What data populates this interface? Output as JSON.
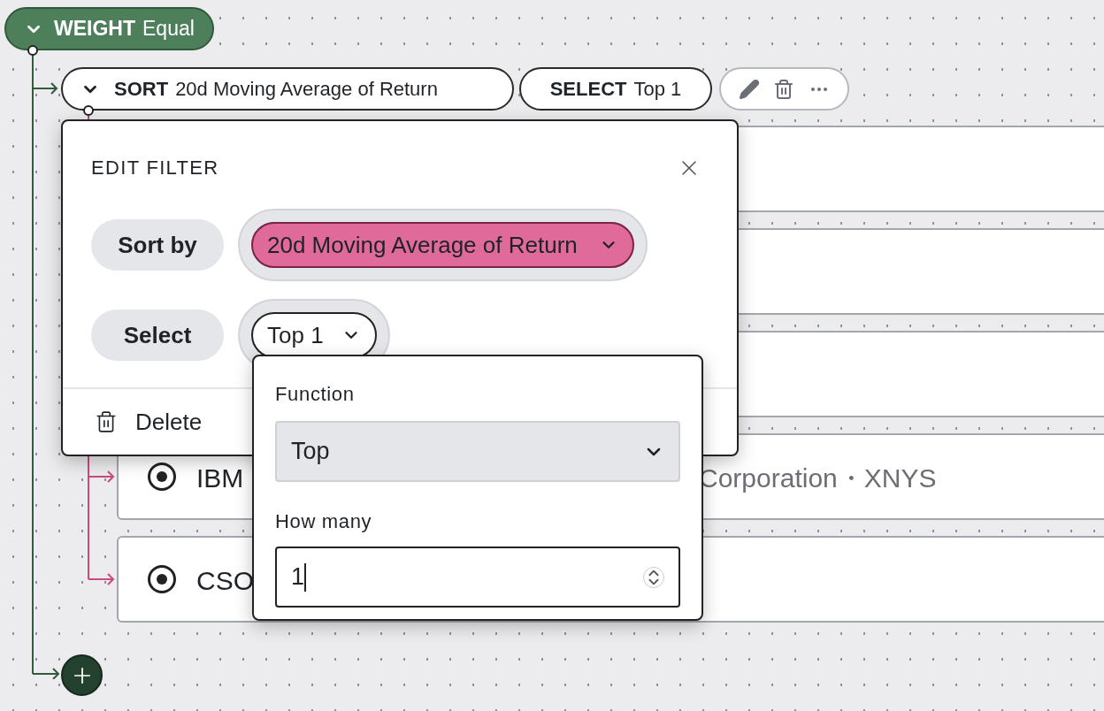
{
  "weight": {
    "keyword": "WEIGHT",
    "value": "Equal",
    "expanded": true
  },
  "sort": {
    "keyword": "SORT",
    "value": "20d Moving Average of Return",
    "expanded": true
  },
  "select": {
    "keyword": "SELECT",
    "value": "Top 1"
  },
  "rows": [
    {
      "kind": "covered"
    },
    {
      "kind": "covered"
    },
    {
      "kind": "covered"
    },
    {
      "kind": "asset",
      "selected": true,
      "ticker": "IBM",
      "description": "Corporation・XNYS"
    },
    {
      "kind": "asset",
      "selected": true,
      "ticker": "CSO"
    }
  ],
  "dialog": {
    "title": "EDIT FILTER",
    "fields": [
      {
        "kind": "metric",
        "label": "Sort by",
        "value": "20d Moving Average of Return"
      },
      {
        "kind": "plain",
        "label": "Select",
        "value": "Top 1"
      }
    ],
    "delete": "Delete"
  },
  "popover": {
    "function_label": "Function",
    "function_value": "Top",
    "count_label": "How many",
    "count_value": "1"
  }
}
